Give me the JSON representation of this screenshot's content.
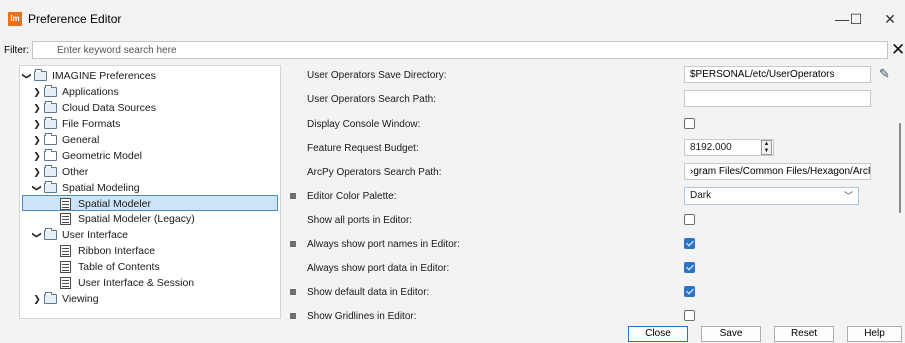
{
  "window": {
    "app_icon_text": "Im",
    "title": "Preference Editor",
    "minimize": "—",
    "maximize": "☐",
    "close": "✕"
  },
  "filter": {
    "label": "Filter:",
    "placeholder": "Enter keyword search here",
    "clear": "✕"
  },
  "tree": [
    {
      "label": "IMAGINE Preferences",
      "expanded": true,
      "level": 0,
      "kind": "folder"
    },
    {
      "label": "Applications",
      "expanded": false,
      "level": 1,
      "kind": "folder"
    },
    {
      "label": "Cloud Data Sources",
      "expanded": false,
      "level": 1,
      "kind": "folder"
    },
    {
      "label": "File Formats",
      "expanded": false,
      "level": 1,
      "kind": "folder"
    },
    {
      "label": "General",
      "expanded": false,
      "level": 1,
      "kind": "folder"
    },
    {
      "label": "Geometric Model",
      "expanded": false,
      "level": 1,
      "kind": "folder"
    },
    {
      "label": "Other",
      "expanded": false,
      "level": 1,
      "kind": "folder"
    },
    {
      "label": "Spatial Modeling",
      "expanded": true,
      "level": 1,
      "kind": "folder"
    },
    {
      "label": "Spatial Modeler",
      "level": 2,
      "kind": "page",
      "selected": true
    },
    {
      "label": "Spatial Modeler (Legacy)",
      "level": 2,
      "kind": "page"
    },
    {
      "label": "User Interface",
      "expanded": true,
      "level": 1,
      "kind": "folder"
    },
    {
      "label": "Ribbon Interface",
      "level": 2,
      "kind": "page"
    },
    {
      "label": "Table of Contents",
      "level": 2,
      "kind": "page"
    },
    {
      "label": "User Interface & Session",
      "level": 2,
      "kind": "page"
    },
    {
      "label": "Viewing",
      "expanded": false,
      "level": 1,
      "kind": "folder"
    }
  ],
  "settings": {
    "user_ops_save_dir": {
      "label": "User Operators Save Directory:",
      "value": "$PERSONAL/etc/UserOperators"
    },
    "user_ops_search_path": {
      "label": "User Operators Search Path:",
      "value": ""
    },
    "display_console": {
      "label": "Display Console Window:",
      "checked": false
    },
    "feature_request_budget": {
      "label": "Feature Request Budget:",
      "value": "8192.000"
    },
    "arcpy_search_path": {
      "label": "ArcPy Operators Search Path:",
      "value": "›gram Files/Common Files/Hexagon/ArcPy"
    },
    "editor_color_palette": {
      "label": "Editor Color Palette:",
      "value": "Dark"
    },
    "show_all_ports": {
      "label": "Show all ports in Editor:",
      "checked": false
    },
    "show_port_names": {
      "label": "Always show port names in Editor:",
      "checked": true
    },
    "show_port_data": {
      "label": "Always show port data in Editor:",
      "checked": true
    },
    "show_default_data": {
      "label": "Show default data in Editor:",
      "checked": true
    },
    "show_gridlines": {
      "label": "Show Gridlines in Editor:",
      "checked": false
    }
  },
  "buttons": {
    "close": "Close",
    "save": "Save",
    "reset": "Reset",
    "help": "Help"
  },
  "colors": {
    "accent": "#2a73c5",
    "selection": "#cce4f7",
    "app_icon": "#e8731c"
  }
}
